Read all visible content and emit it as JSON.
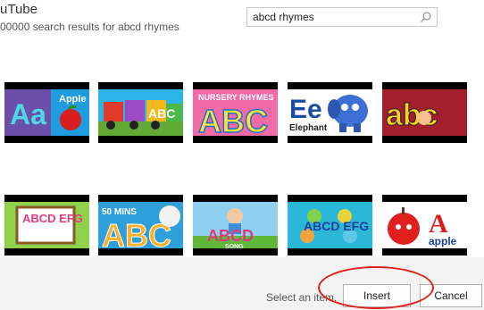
{
  "header": {
    "title": "uTube",
    "result_count": "00000 search results for abcd rhymes"
  },
  "search": {
    "value": "abcd rhymes",
    "icon": "search-icon"
  },
  "results": [
    {
      "letters": "Aa",
      "caption": "Apple"
    },
    {
      "letters": "ABC",
      "caption": ""
    },
    {
      "letters": "ABC",
      "caption": "NURSERY RHYMES"
    },
    {
      "letters": "Ee",
      "caption": "Elephant"
    },
    {
      "letters": "abc",
      "caption": ""
    },
    {
      "letters": "ABCD EFG",
      "caption": ""
    },
    {
      "letters": "ABC",
      "caption": "50 MINS"
    },
    {
      "letters": "ABCD",
      "caption": "SONG"
    },
    {
      "letters": "ABCD EFG",
      "caption": ""
    },
    {
      "letters": "A",
      "caption": "apple"
    }
  ],
  "footer": {
    "status": "Select an item.",
    "insert_label": "Insert",
    "cancel_label": "Cancel"
  },
  "colors": {
    "accent_circle": "#e0201a",
    "footer_bg": "#f3f3f3"
  }
}
